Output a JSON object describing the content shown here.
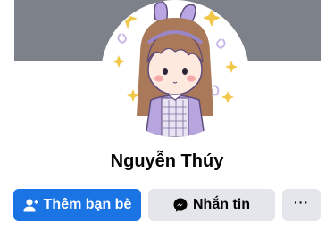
{
  "profile": {
    "name": "Nguyễn Thúy"
  },
  "actions": {
    "add_friend_label": "Thêm bạn bè",
    "message_label": "Nhắn tin",
    "more_label": "···"
  },
  "icons": {
    "add_friend": "person-plus-icon",
    "message": "messenger-icon",
    "more": "ellipsis-icon"
  },
  "colors": {
    "cover": "#7d8189",
    "primary_button": "#1b74e4",
    "secondary_button": "#e4e6eb"
  }
}
